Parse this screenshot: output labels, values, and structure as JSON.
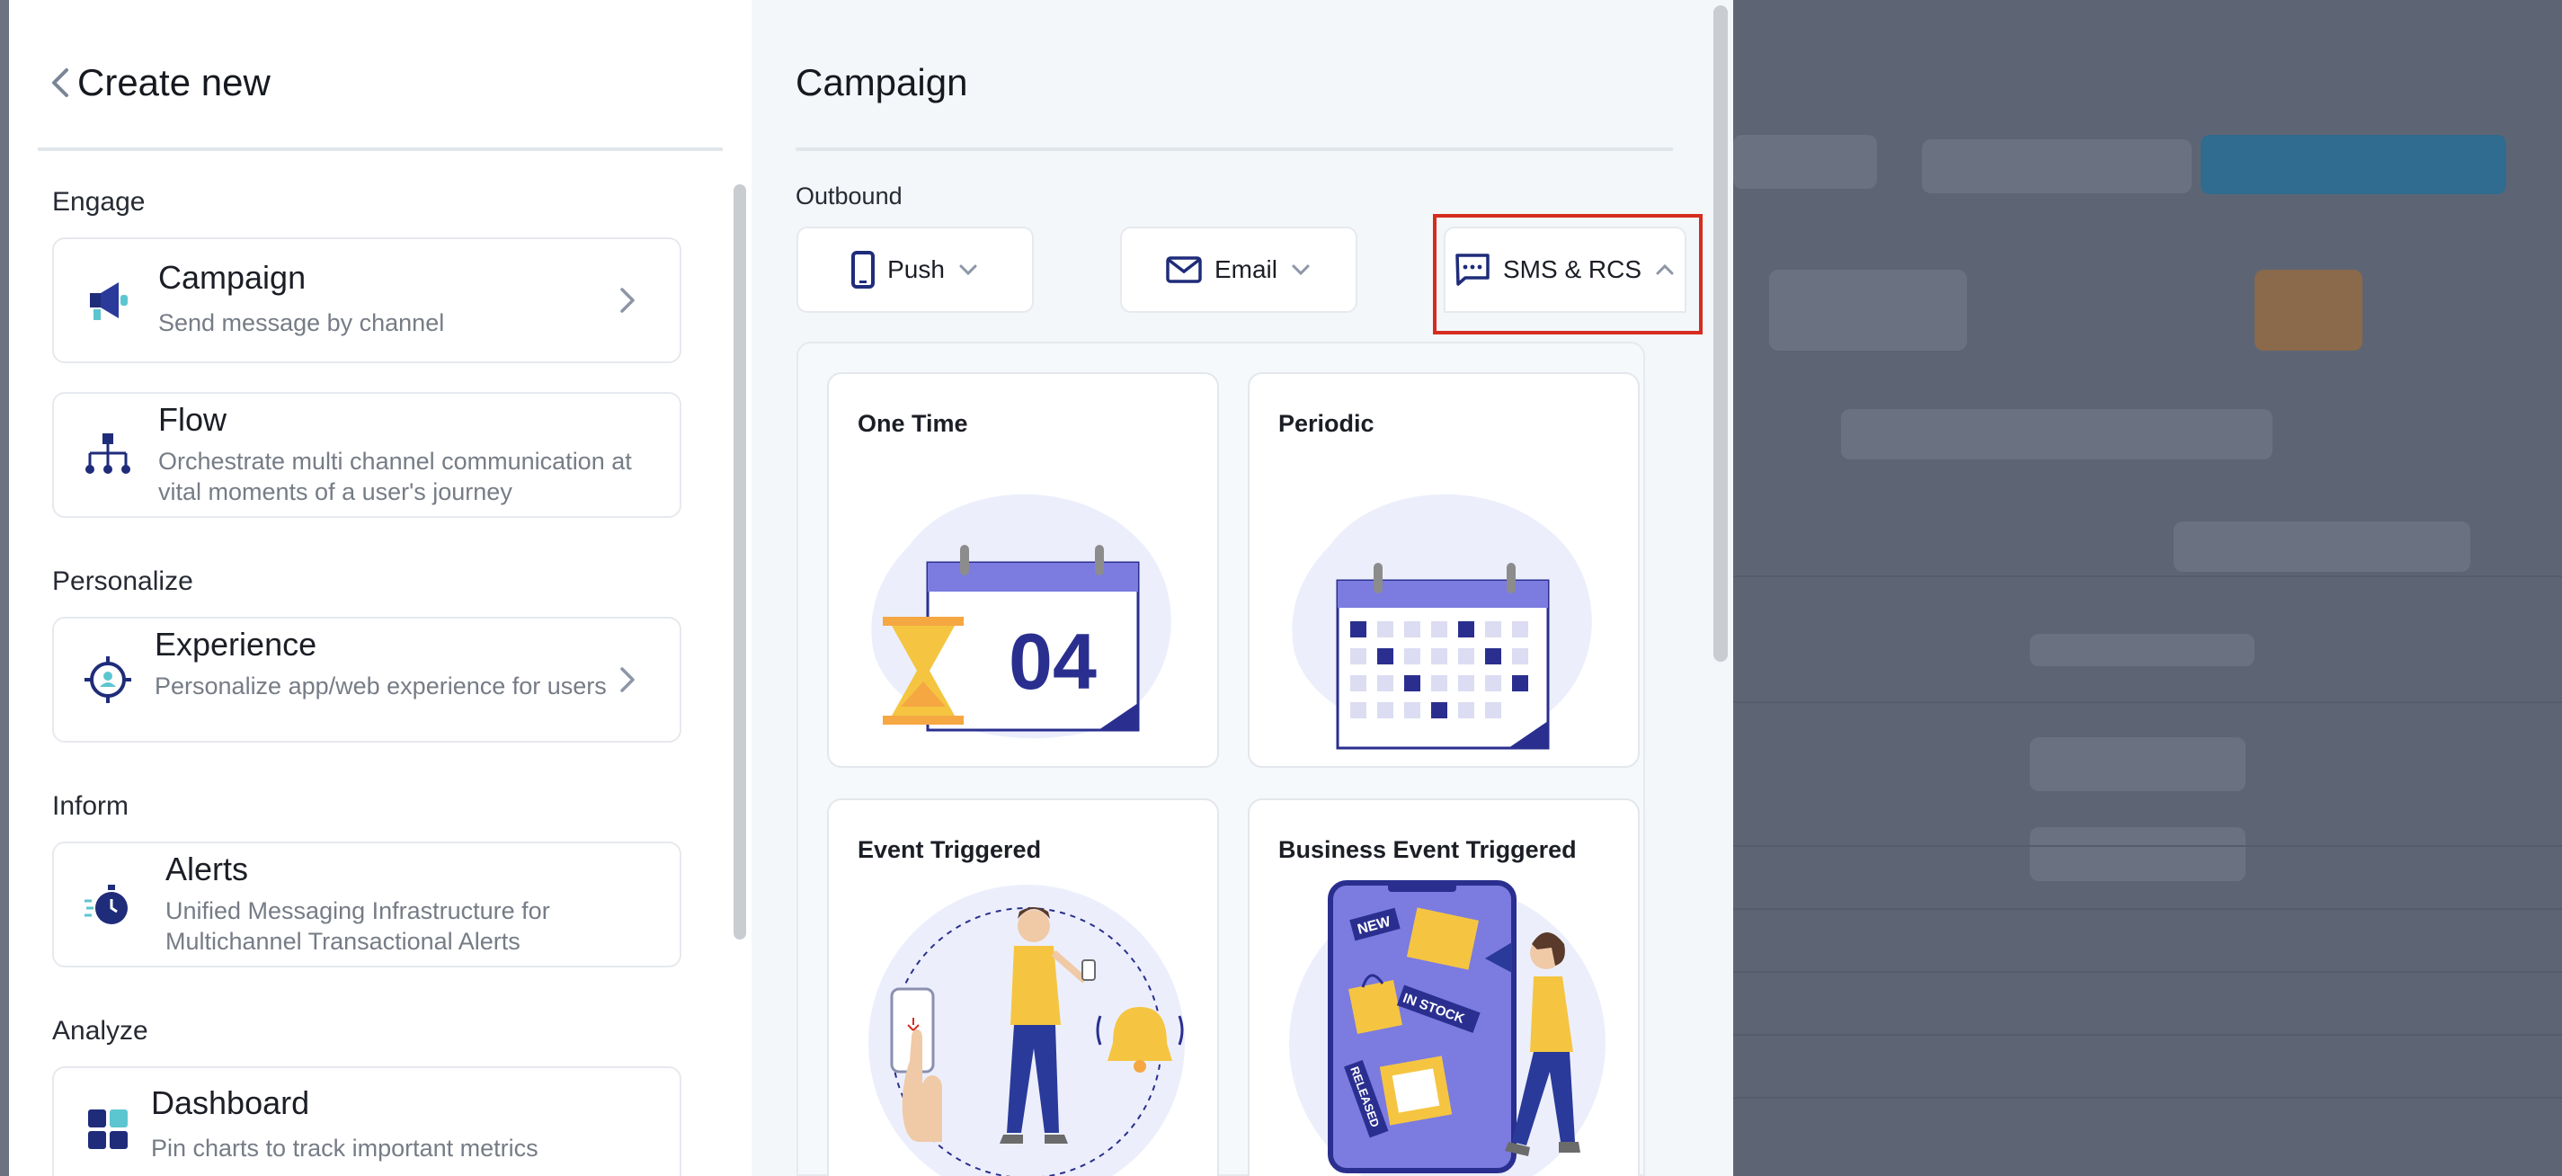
{
  "left_panel": {
    "title": "Create new",
    "sections": [
      {
        "label": "Engage"
      },
      {
        "label": "Personalize"
      },
      {
        "label": "Inform"
      },
      {
        "label": "Analyze"
      }
    ],
    "cards": [
      {
        "title": "Campaign",
        "desc": "Send message by channel",
        "icon": "megaphone-icon",
        "has_arrow": true
      },
      {
        "title": "Flow",
        "desc": "Orchestrate multi channel communication at vital moments of a user's journey",
        "icon": "flow-hierarchy-icon",
        "has_arrow": false
      },
      {
        "title": "Experience",
        "desc": "Personalize app/web experience for users",
        "icon": "target-user-icon",
        "has_arrow": true
      },
      {
        "title": "Alerts",
        "desc": "Unified Messaging Infrastructure for Multichannel Transactional Alerts",
        "icon": "stopwatch-icon",
        "has_arrow": false
      },
      {
        "title": "Dashboard",
        "desc": "Pin charts to track important metrics",
        "icon": "dashboard-grid-icon",
        "has_arrow": false
      }
    ]
  },
  "right_panel": {
    "title": "Campaign",
    "outbound_label": "Outbound",
    "channels": [
      {
        "label": "Push",
        "icon": "mobile-phone-icon",
        "expanded": false
      },
      {
        "label": "Email",
        "icon": "envelope-icon",
        "expanded": false
      },
      {
        "label": "SMS & RCS",
        "icon": "chat-bubble-icon",
        "expanded": true
      }
    ],
    "tiles": [
      {
        "label": "One Time",
        "art_text": "04"
      },
      {
        "label": "Periodic"
      },
      {
        "label": "Event Triggered"
      },
      {
        "label": "Business Event Triggered",
        "badges": [
          "NEW",
          "IN STOCK",
          "RELEASED"
        ]
      }
    ]
  },
  "colors": {
    "accent": "#2a2f8f",
    "highlight": "#d62c20",
    "illustration_purple": "#7b7be0",
    "illustration_yellow": "#f5c542"
  }
}
